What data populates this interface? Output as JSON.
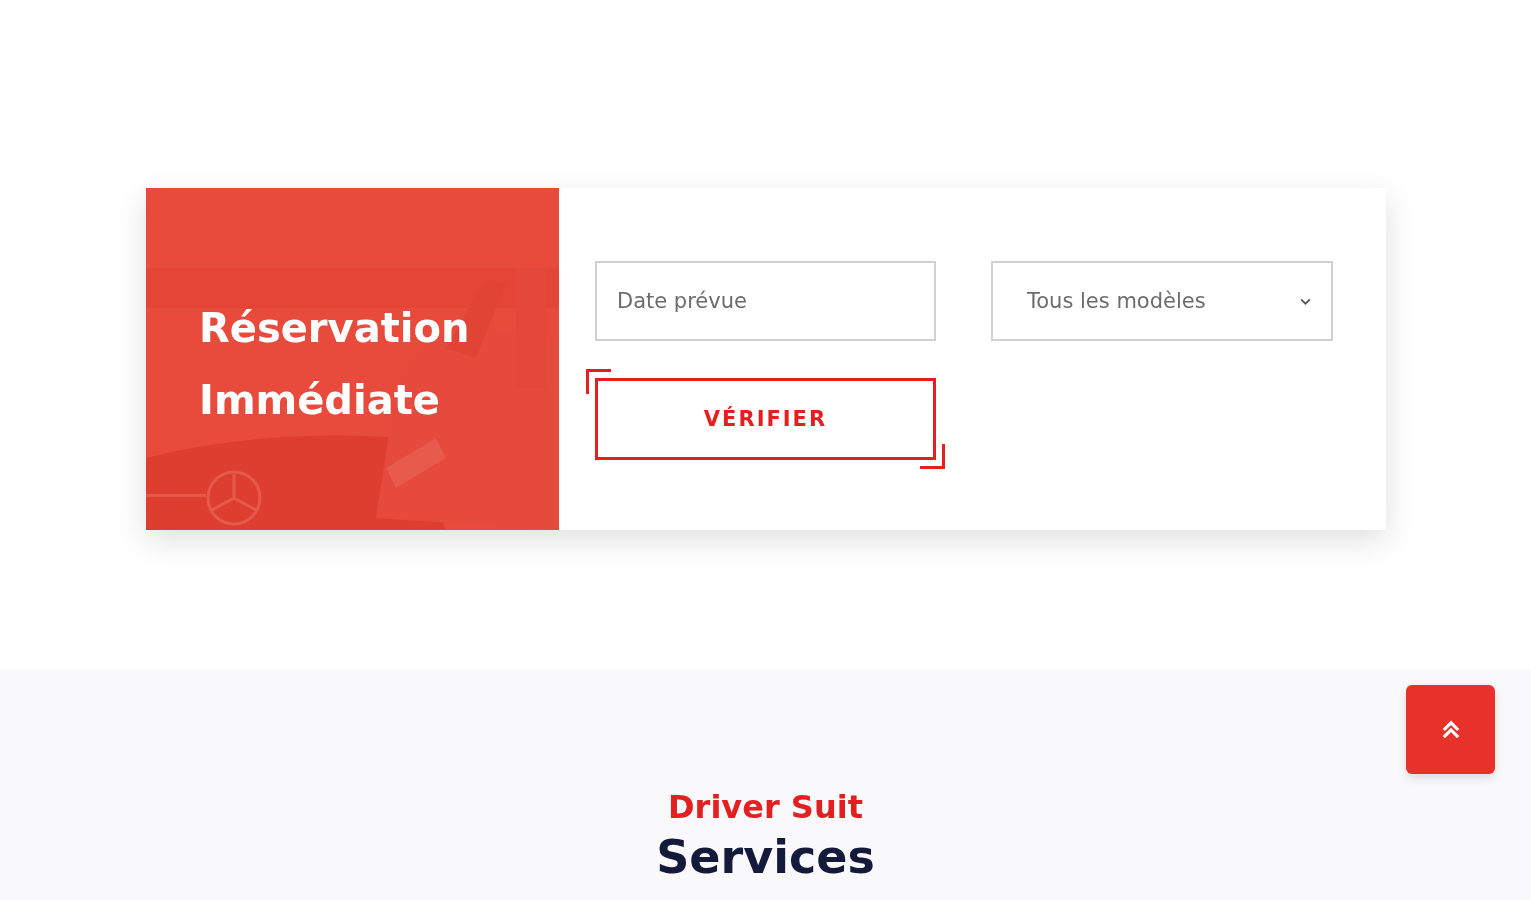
{
  "booking": {
    "title_lines": [
      "Réservation",
      "Immédiate"
    ],
    "date_field": {
      "placeholder": "Date prévue"
    },
    "model_select": {
      "value": "Tous les modèles"
    },
    "button": "VÉRIFIER"
  },
  "section": {
    "eyebrow": "Driver Suit",
    "heading": "Services"
  }
}
